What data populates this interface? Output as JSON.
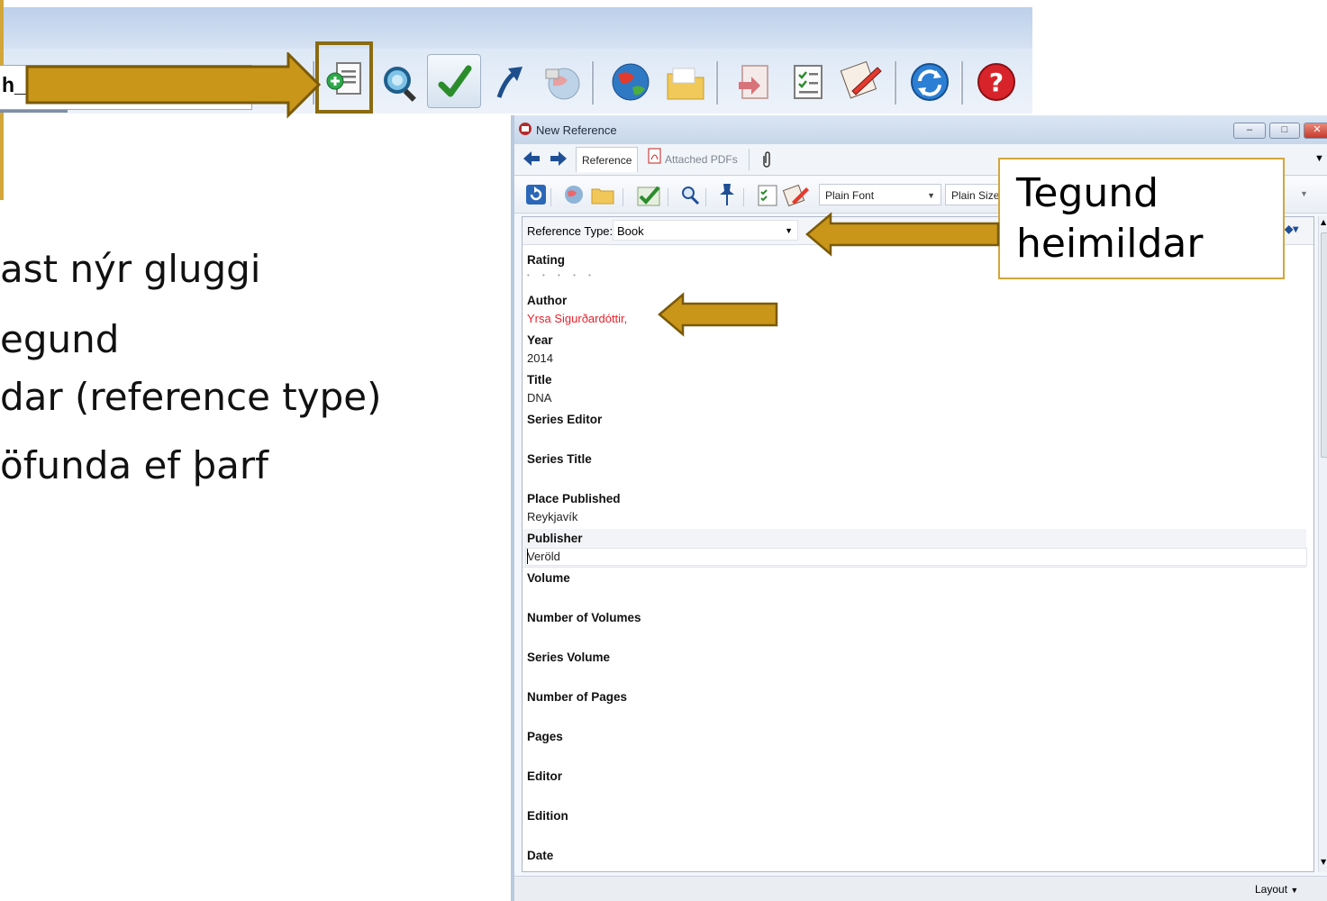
{
  "main_toolbar": {
    "library_field_text": "h_I",
    "icons": [
      "library-icon",
      "new-reference-icon",
      "search-library-icon",
      "check-icon",
      "export-arrow-icon",
      "online-search-icon",
      "web-icon",
      "folder-icon",
      "insert-citation-icon",
      "format-bibliography-icon",
      "edit-manuscript-icon",
      "sync-icon",
      "help-icon"
    ]
  },
  "slide": {
    "bullets": [
      "ast nýr gluggi",
      "egund",
      "dar (reference type)",
      "öfunda ef þarf"
    ]
  },
  "callout": {
    "line1": "Tegund",
    "line2": "heimildar"
  },
  "window": {
    "title": "New Reference",
    "tabs": {
      "reference": "Reference",
      "attached_pdfs": "Attached PDFs"
    },
    "font_combo": "Plain Font",
    "size_combo": "Plain Size",
    "reference_type_label": "Reference Type:",
    "reference_type_value": "Book",
    "fields": [
      {
        "label": "Rating",
        "value": "• • • • •"
      },
      {
        "label": "Author",
        "value": "Yrsa Sigurðardóttir,"
      },
      {
        "label": "Year",
        "value": "2014"
      },
      {
        "label": "Title",
        "value": "DNA"
      },
      {
        "label": "Series Editor",
        "value": ""
      },
      {
        "label": "Series Title",
        "value": ""
      },
      {
        "label": "Place Published",
        "value": "Reykjavík"
      },
      {
        "label": "Publisher",
        "value": "Veröld"
      },
      {
        "label": "Volume",
        "value": ""
      },
      {
        "label": "Number of Volumes",
        "value": ""
      },
      {
        "label": "Series Volume",
        "value": ""
      },
      {
        "label": "Number of Pages",
        "value": ""
      },
      {
        "label": "Pages",
        "value": ""
      },
      {
        "label": "Editor",
        "value": ""
      },
      {
        "label": "Edition",
        "value": ""
      },
      {
        "label": "Date",
        "value": ""
      }
    ],
    "status": {
      "layout_label": "Layout"
    }
  },
  "colors": {
    "arrow": "#c9961a",
    "arrow_outline": "#7a5a08",
    "callout_border": "#d2a63a",
    "author_red": "#e8202a"
  }
}
